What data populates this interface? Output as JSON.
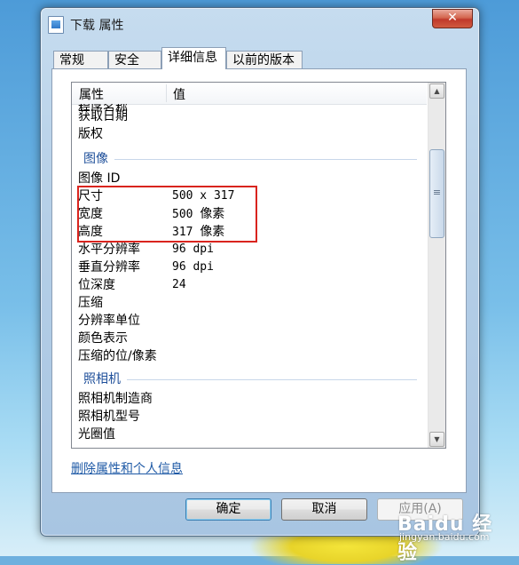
{
  "window": {
    "title": "下载 属性",
    "close_glyph": "✕"
  },
  "tabs": [
    "常规",
    "安全",
    "详细信息",
    "以前的版本"
  ],
  "list": {
    "headers": {
      "property": "属性",
      "value": "值"
    },
    "partial_top_row": "程序名称",
    "rows_top": [
      {
        "label": "获取日期",
        "value": ""
      },
      {
        "label": "版权",
        "value": ""
      }
    ],
    "group_image": "图像",
    "rows_image": [
      {
        "label": "图像 ID",
        "value": ""
      },
      {
        "label": "尺寸",
        "value": "500 x 317"
      },
      {
        "label": "宽度",
        "value_num": "500",
        "value_unit": "像素"
      },
      {
        "label": "高度",
        "value_num": "317",
        "value_unit": "像素"
      },
      {
        "label": "水平分辨率",
        "value": "96 dpi"
      },
      {
        "label": "垂直分辨率",
        "value": "96 dpi"
      },
      {
        "label": "位深度",
        "value": "24"
      },
      {
        "label": "压缩",
        "value": ""
      },
      {
        "label": "分辨率单位",
        "value": ""
      },
      {
        "label": "颜色表示",
        "value": ""
      },
      {
        "label": "压缩的位/像素",
        "value": ""
      }
    ],
    "group_camera": "照相机",
    "rows_camera": [
      {
        "label": "照相机制造商",
        "value": ""
      },
      {
        "label": "照相机型号",
        "value": ""
      },
      {
        "label": "光圈值",
        "value": ""
      }
    ]
  },
  "remove_link": "删除属性和个人信息",
  "buttons": {
    "ok": "确定",
    "cancel": "取消",
    "apply": "应用(A)"
  },
  "watermark": {
    "logo": "Baidu 经验",
    "url": "jingyan.baidu.com"
  },
  "colors": {
    "highlight_box": "#d9241e",
    "group_text": "#1e4f9a",
    "link": "#1f5aa6"
  }
}
